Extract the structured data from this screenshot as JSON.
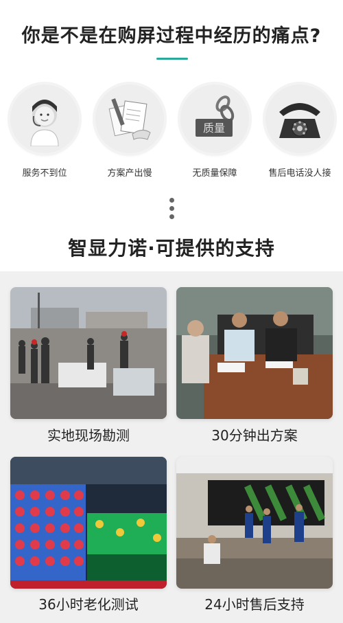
{
  "headline": "你是不是在购屏过程中经历的痛点?",
  "pain_points": [
    {
      "label": "服务不到位",
      "icon": "customer-service-icon"
    },
    {
      "label": "方案产出慢",
      "icon": "documents-icon"
    },
    {
      "label": "无质量保障",
      "icon": "quality-chain-icon"
    },
    {
      "label": "售后电话没人接",
      "icon": "telephone-icon"
    }
  ],
  "stamp_text": "质量",
  "subheadline": "智显力诺·可提供的支持",
  "supports": [
    {
      "label": "实地现场勘测"
    },
    {
      "label": "30分钟出方案"
    },
    {
      "label": "36小时老化测试"
    },
    {
      "label": "24小时售后支持"
    }
  ],
  "colors": {
    "accent": "#2aa89a",
    "panel_bg": "#f0f0f0"
  }
}
